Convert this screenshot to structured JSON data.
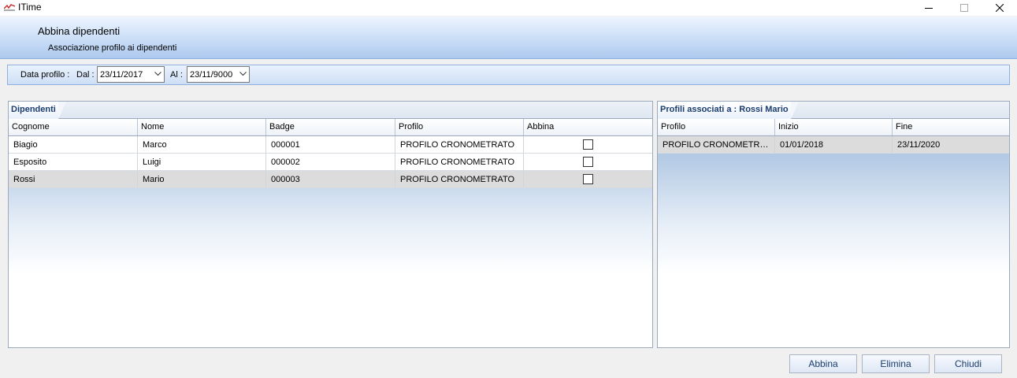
{
  "window": {
    "title": "ITime",
    "logo_icon": "itime-logo-icon"
  },
  "header": {
    "title": "Abbina dipendenti",
    "subtitle": "Associazione profilo ai dipendenti"
  },
  "filter": {
    "label": "Data profilo :",
    "from_label": "Dal :",
    "from_value": "23/11/2017",
    "to_label": "Al :",
    "to_value": "23/11/9000"
  },
  "employees": {
    "tab_label": "Dipendenti",
    "columns": [
      "Cognome",
      "Nome",
      "Badge",
      "Profilo",
      "Abbina"
    ],
    "rows": [
      {
        "cognome": "Biagio",
        "nome": "Marco",
        "badge": "000001",
        "profilo": "PROFILO CRONOMETRATO",
        "abbina": false
      },
      {
        "cognome": "Esposito",
        "nome": "Luigi",
        "badge": "000002",
        "profilo": "PROFILO CRONOMETRATO",
        "abbina": false
      },
      {
        "cognome": "Rossi",
        "nome": "Mario",
        "badge": "000003",
        "profilo": "PROFILO CRONOMETRATO",
        "abbina": false
      }
    ],
    "selected_row": 2
  },
  "profiles": {
    "tab_label": "Profili associati a : Rossi Mario",
    "columns": [
      "Profilo",
      "Inizio",
      "Fine"
    ],
    "rows": [
      {
        "profilo": "PROFILO CRONOMETRATO",
        "inizio": "01/01/2018",
        "fine": "23/11/2020"
      }
    ]
  },
  "buttons": {
    "abbina": "Abbina",
    "elimina": "Elimina",
    "chiudi": "Chiudi"
  },
  "colors": {
    "accent_text": "#1b3d6d",
    "header_gradient_bottom": "#aec9ee",
    "selected_row": "#dcdcdc"
  }
}
